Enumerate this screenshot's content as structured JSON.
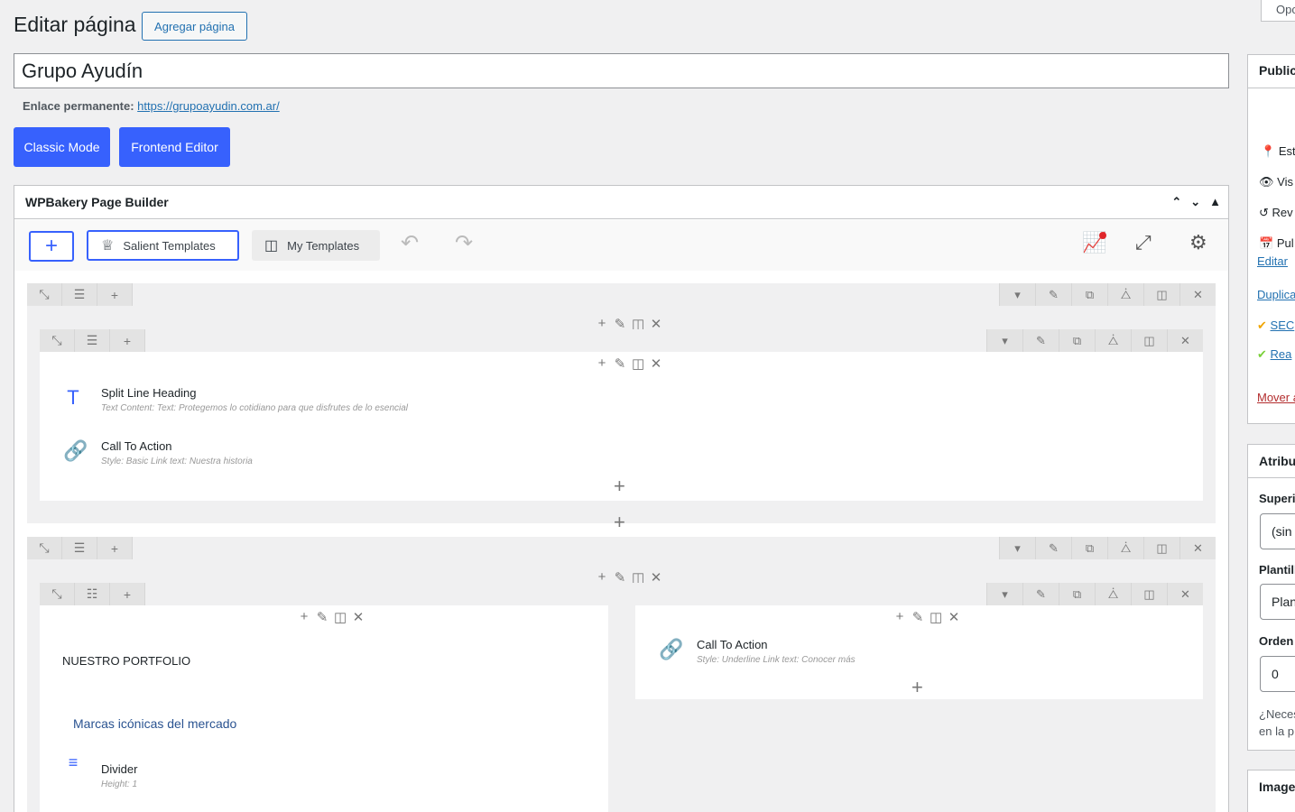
{
  "header": {
    "page_title": "Editar página",
    "add_page_button": "Agregar página",
    "screen_options": "Opc"
  },
  "post": {
    "title": "Grupo Ayudín",
    "permalink_label": "Enlace permanente:",
    "permalink_url": "https://grupoayudin.com.ar/"
  },
  "modes": {
    "classic": "Classic Mode",
    "frontend": "Frontend Editor"
  },
  "builder": {
    "title": "WPBakery Page Builder",
    "salient_templates": "Salient Templates",
    "my_templates": "My Templates",
    "rows": [
      {
        "elements": [
          {
            "name": "Split Line Heading",
            "icon": "text-icon",
            "desc": "Text Content:   Text: Protegemos lo cotidiano para que disfrutes de lo esencial"
          },
          {
            "name": "Call To Action",
            "icon": "link-icon",
            "desc": "Style: Basic  Link text: Nuestra historia"
          }
        ]
      },
      {
        "left_column": {
          "heading": "NUESTRO PORTFOLIO",
          "subheading": "Marcas icónicas del mercado",
          "divider_name": "Divider",
          "divider_desc": "Height: 1"
        },
        "right_column": {
          "name": "Call To Action",
          "desc": "Style: Underline  Link text: Conocer más"
        }
      }
    ]
  },
  "sidebar": {
    "publish": {
      "title": "Publica",
      "status": "Est",
      "visibility": "Vis",
      "revisions": "Rev",
      "published": "Pul",
      "edit": "Editar",
      "duplicate": "Duplica",
      "seo": "SEC",
      "readability": "Rea",
      "trash": "Mover a"
    },
    "attributes": {
      "title": "Atribu",
      "parent_label": "Superio",
      "parent_value": "(sin",
      "template_label": "Plantill",
      "template_value": "Plan",
      "order_label": "Orden",
      "order_value": "0",
      "help_line1": "¿Neces",
      "help_line2": "en la p"
    },
    "image": {
      "title": "Image"
    }
  }
}
